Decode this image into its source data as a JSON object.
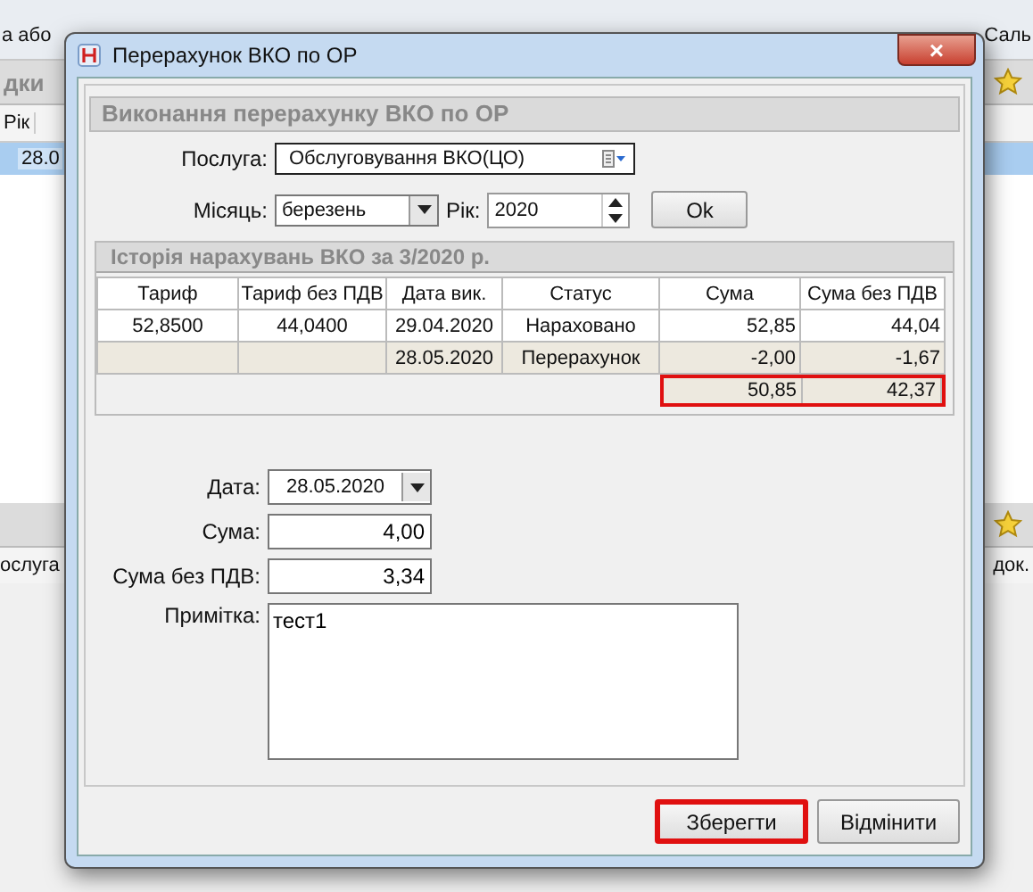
{
  "background": {
    "tab_text": "а або",
    "right_tab_text": "Саль",
    "panel_title": "дки",
    "columns": [
      "Рік"
    ],
    "selected_cell": "28.0",
    "lower_left_text": "ослуга",
    "lower_right_text": "док."
  },
  "dialog": {
    "title": "Перерахунок ВКО по ОР",
    "close_label": "×",
    "section_title": "Виконання перерахунку ВКО по ОР",
    "service": {
      "label": "Послуга:",
      "value": "Обслуговування ВКО(ЦО)"
    },
    "month": {
      "label": "Місяць:",
      "value": "березень"
    },
    "year": {
      "label": "Рік:",
      "value": "2020"
    },
    "ok_button": "Ok",
    "history": {
      "title": "Історія нарахувань ВКО за 3/2020 р.",
      "columns": [
        "Тариф",
        "Тариф без ПДВ",
        "Дата вик.",
        "Статус",
        "Сума",
        "Сума без ПДВ"
      ],
      "rows": [
        {
          "cells": [
            "52,8500",
            "44,0400",
            "29.04.2020",
            "Нараховано",
            "52,85",
            "44,04"
          ],
          "shaded": false
        },
        {
          "cells": [
            "",
            "",
            "28.05.2020",
            "Перерахунок",
            "-2,00",
            "-1,67"
          ],
          "shaded": true
        }
      ],
      "totals": {
        "sum": "50,85",
        "sum_no_vat": "42,37",
        "highlighted": true
      }
    },
    "date": {
      "label": "Дата:",
      "value": "28.05.2020"
    },
    "sum": {
      "label": "Сума:",
      "value": "4,00"
    },
    "sum_no_vat": {
      "label": "Сума без ПДВ:",
      "value": "3,34"
    },
    "note": {
      "label": "Примітка:",
      "value": "тест1"
    },
    "buttons": [
      {
        "label": "Зберегти",
        "highlighted": true
      },
      {
        "label": "Відмінити",
        "highlighted": false
      }
    ]
  }
}
